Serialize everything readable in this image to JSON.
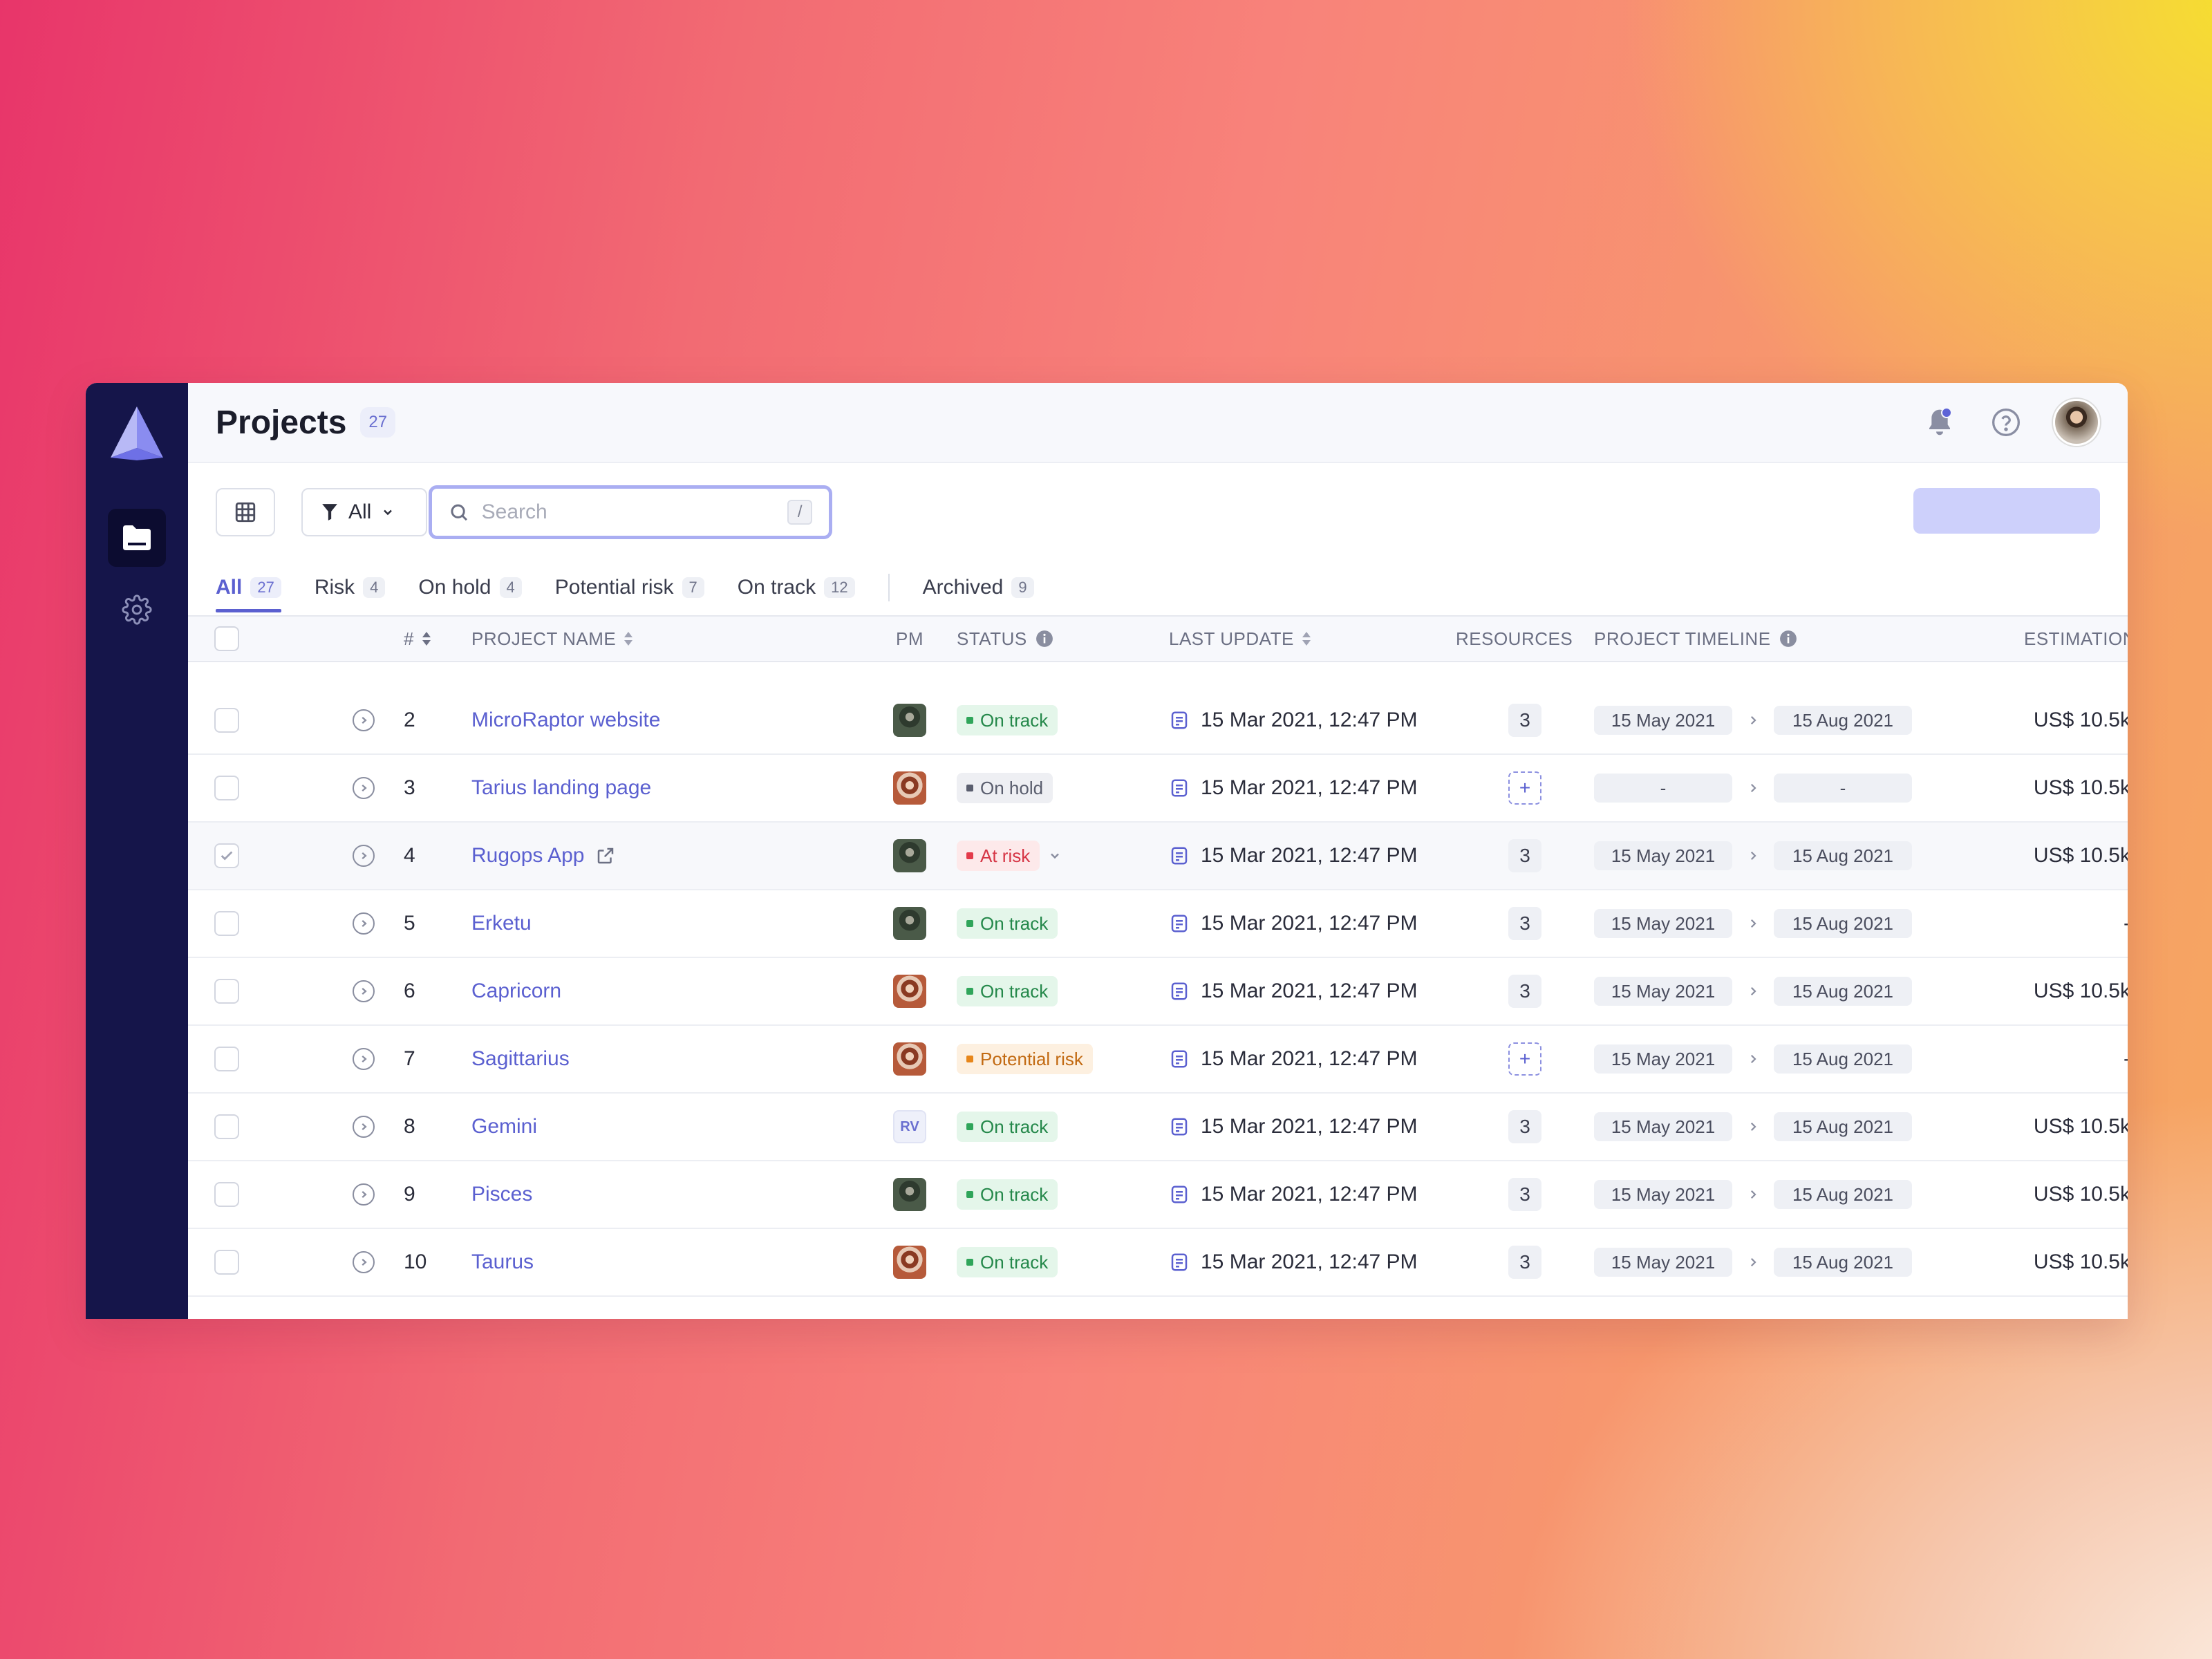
{
  "header": {
    "title": "Projects",
    "count": "27"
  },
  "toolbar": {
    "filter_label": "All",
    "search_placeholder": "Search",
    "search_shortcut": "/"
  },
  "tabs": [
    {
      "label": "All",
      "count": "27"
    },
    {
      "label": "Risk",
      "count": "4"
    },
    {
      "label": "On hold",
      "count": "4"
    },
    {
      "label": "Potential risk",
      "count": "7"
    },
    {
      "label": "On track",
      "count": "12"
    },
    {
      "label": "Archived",
      "count": "9"
    }
  ],
  "columns": {
    "num": "#",
    "name": "PROJECT NAME",
    "pm": "PM",
    "status": "STATUS",
    "update": "LAST UPDATE",
    "resources": "RESOURCES",
    "timeline": "PROJECT TIMELINE",
    "estimation": "ESTIMATION"
  },
  "rows": [
    {
      "num": "2",
      "name": "MicroRaptor website",
      "pm": "dark",
      "status": "On track",
      "status_kind": "on",
      "update": "15 Mar 2021, 12:47 PM",
      "resources": "3",
      "start": "15 May 2021",
      "end": "15 Aug 2021",
      "estimation": "US$ 10.5k"
    },
    {
      "num": "3",
      "name": "Tarius landing page",
      "pm": "red",
      "status": "On hold",
      "status_kind": "hold",
      "update": "15 Mar 2021, 12:47 PM",
      "resources": "+",
      "start": "-",
      "end": "-",
      "estimation": "US$ 10.5k"
    },
    {
      "num": "4",
      "name": "Rugops App",
      "pm": "dark",
      "status": "At risk",
      "status_kind": "risk",
      "update": "15 Mar 2021, 12:47 PM",
      "resources": "3",
      "start": "15 May 2021",
      "end": "15 Aug 2021",
      "estimation": "US$ 10.5k"
    },
    {
      "num": "5",
      "name": "Erketu",
      "pm": "dark",
      "status": "On track",
      "status_kind": "on",
      "update": "15 Mar 2021, 12:47 PM",
      "resources": "3",
      "start": "15 May 2021",
      "end": "15 Aug 2021",
      "estimation": "-"
    },
    {
      "num": "6",
      "name": "Capricorn",
      "pm": "red",
      "status": "On track",
      "status_kind": "on",
      "update": "15 Mar 2021, 12:47 PM",
      "resources": "3",
      "start": "15 May 2021",
      "end": "15 Aug 2021",
      "estimation": "US$ 10.5k"
    },
    {
      "num": "7",
      "name": "Sagittarius",
      "pm": "red",
      "status": "Potential risk",
      "status_kind": "pot",
      "update": "15 Mar 2021, 12:47 PM",
      "resources": "+",
      "start": "15 May 2021",
      "end": "15 Aug 2021",
      "estimation": "-"
    },
    {
      "num": "8",
      "name": "Gemini",
      "pm": "RV",
      "status": "On track",
      "status_kind": "on",
      "update": "15 Mar 2021, 12:47 PM",
      "resources": "3",
      "start": "15 May 2021",
      "end": "15 Aug 2021",
      "estimation": "US$ 10.5k"
    },
    {
      "num": "9",
      "name": "Pisces",
      "pm": "dark",
      "status": "On track",
      "status_kind": "on",
      "update": "15 Mar 2021, 12:47 PM",
      "resources": "3",
      "start": "15 May 2021",
      "end": "15 Aug 2021",
      "estimation": "US$ 10.5k"
    },
    {
      "num": "10",
      "name": "Taurus",
      "pm": "red",
      "status": "On track",
      "status_kind": "on",
      "update": "15 Mar 2021, 12:47 PM",
      "resources": "3",
      "start": "15 May 2021",
      "end": "15 Aug 2021",
      "estimation": "US$ 10.5k"
    }
  ],
  "colors": {
    "sidebar": "#15154a",
    "accent": "#5b60d0"
  }
}
